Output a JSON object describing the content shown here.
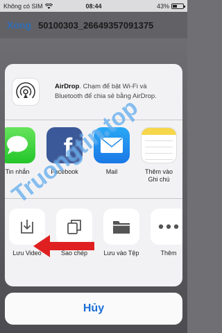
{
  "status_bar": {
    "carrier": "Không có SIM",
    "time": "08:44",
    "battery": "43%",
    "battery_level": 0.43
  },
  "nav": {
    "done": "Xong",
    "title": "50100303_26649357091375"
  },
  "airdrop": {
    "title": "AirDrop",
    "description": ". Chạm để bật Wi-Fi và Bluetooth để chia sẻ bằng AirDrop."
  },
  "apps": [
    {
      "label": "Tin nhắn",
      "icon": "messages-icon"
    },
    {
      "label": "Facebook",
      "icon": "facebook-icon"
    },
    {
      "label": "Mail",
      "icon": "mail-icon"
    },
    {
      "label_line1": "Thêm vào",
      "label_line2": "Ghi chú",
      "icon": "notes-icon"
    }
  ],
  "actions": [
    {
      "label": "Lưu Video",
      "icon": "save-video-icon"
    },
    {
      "label": "Sao chép",
      "icon": "copy-icon"
    },
    {
      "label": "Lưu vào Tệp",
      "icon": "folder-icon"
    },
    {
      "label": "Thêm",
      "icon": "more-icon"
    }
  ],
  "cancel": "Hủy",
  "watermark": "Truongtin.top",
  "colors": {
    "accent": "#1a6fd9",
    "arrow": "#e02020",
    "facebook": "#3b5998"
  }
}
